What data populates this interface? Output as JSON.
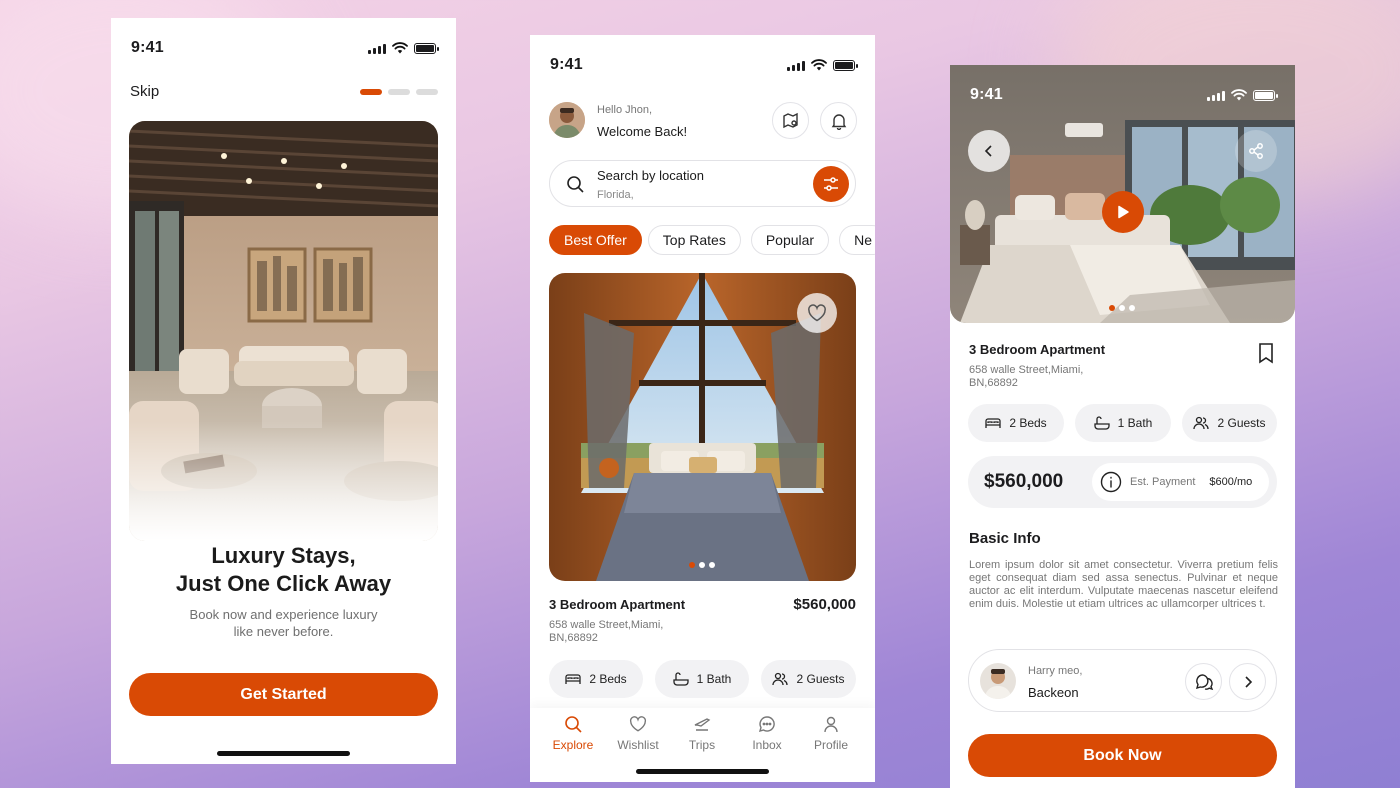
{
  "status": {
    "time": "9:41"
  },
  "onboarding": {
    "skip_label": "Skip",
    "pager": {
      "count": 3,
      "active": 0
    },
    "title_line1": "Luxury Stays,",
    "title_line2": "Just One Click Away",
    "subtitle_line1": "Book now and experience luxury",
    "subtitle_line2": "like never before.",
    "cta_label": "Get Started"
  },
  "explore": {
    "greeting": "Hello Jhon,",
    "welcome": "Welcome Back!",
    "search": {
      "label": "Search by location",
      "value": "Florida,"
    },
    "filters": [
      {
        "label": "Best Offer",
        "active": true
      },
      {
        "label": "Top Rates",
        "active": false
      },
      {
        "label": "Popular",
        "active": false
      },
      {
        "label": "Ne",
        "active": false
      }
    ],
    "listing": {
      "title": "3 Bedroom Apartment",
      "price": "$560,000",
      "address_line1": "658 walle Street,Miami,",
      "address_line2": "BN,68892",
      "carousel": {
        "count": 3,
        "active": 0
      },
      "features": [
        {
          "icon": "bed-icon",
          "label": "2 Beds"
        },
        {
          "icon": "bath-icon",
          "label": "1 Bath"
        },
        {
          "icon": "guests-icon",
          "label": "2 Guests"
        }
      ]
    },
    "nav": [
      {
        "icon": "search-icon",
        "label": "Explore",
        "active": true
      },
      {
        "icon": "heart-icon",
        "label": "Wishlist",
        "active": false
      },
      {
        "icon": "plane-icon",
        "label": "Trips",
        "active": false
      },
      {
        "icon": "chat-icon",
        "label": "Inbox",
        "active": false
      },
      {
        "icon": "user-icon",
        "label": "Profile",
        "active": false
      }
    ]
  },
  "details": {
    "carousel": {
      "count": 3,
      "active": 0
    },
    "title": "3 Bedroom Apartment",
    "address_line1": "658 walle Street,Miami,",
    "address_line2": "BN,68892",
    "features": [
      {
        "icon": "bed-icon",
        "label": "2 Beds"
      },
      {
        "icon": "bath-icon",
        "label": "1 Bath"
      },
      {
        "icon": "guests-icon",
        "label": "2 Guests"
      }
    ],
    "price": "$560,000",
    "est_payment_label": "Est. Payment",
    "est_payment_value": "$600/mo",
    "basic_info_heading": "Basic Info",
    "basic_info_text": "Lorem ipsum dolor sit amet consectetur. Viverra pretium felis eget consequat diam sed assa senectus. Pulvinar et neque auctor ac elit interdum. Vulputate maecenas nascetur eleifend enim duis. Molestie ut etiam ultrices ac ullamcorper ultrices t.",
    "host": {
      "name": "Harry meo,",
      "role": "Backeon"
    },
    "cta_label": "Book Now"
  },
  "colors": {
    "accent": "#d94a05",
    "background": "#a98ad8"
  }
}
